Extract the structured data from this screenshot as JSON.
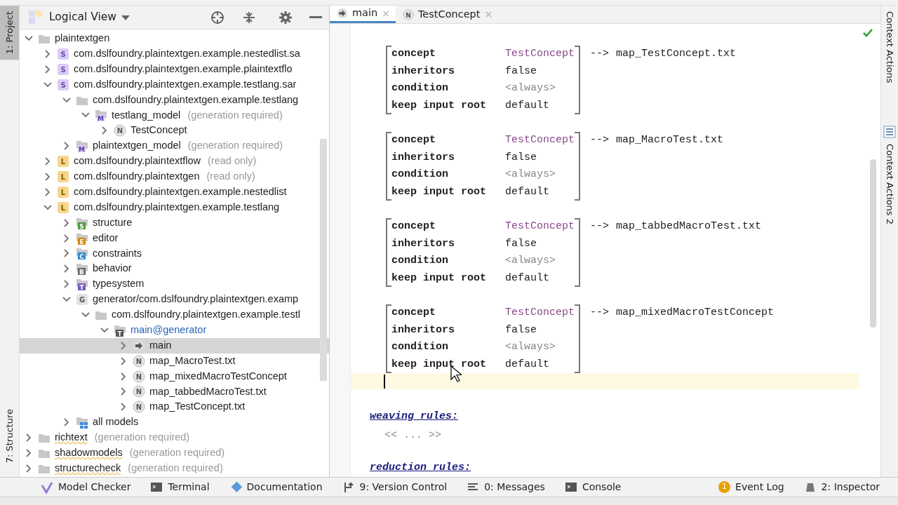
{
  "left_stripe": [
    {
      "label": "1: Project",
      "selected": true
    },
    {
      "label": "7: Structure",
      "selected": false
    }
  ],
  "project_panel": {
    "view": "Logical View",
    "tree": [
      {
        "label": "plaintextgen",
        "kind": "folder",
        "expanded": true,
        "children": [
          {
            "label": "com.dslfoundry.plaintextgen.example.nestedlist.sa",
            "kind": "solution",
            "badge": "S",
            "expanded": false
          },
          {
            "label": "com.dslfoundry.plaintextgen.example.plaintextflo",
            "kind": "solution",
            "badge": "S",
            "expanded": false
          },
          {
            "label": "com.dslfoundry.plaintextgen.example.testlang.sar",
            "kind": "solution",
            "badge": "S",
            "expanded": true,
            "children": [
              {
                "label": "com.dslfoundry.plaintextgen.example.testlang",
                "kind": "folder",
                "expanded": true,
                "children": [
                  {
                    "label": "testlang_model",
                    "note": "(generation required)",
                    "kind": "model",
                    "badge": "M",
                    "expanded": true,
                    "children": [
                      {
                        "label": "TestConcept",
                        "kind": "node",
                        "badge": "N",
                        "expanded": false
                      }
                    ]
                  }
                ]
              },
              {
                "label": "plaintextgen_model",
                "note": "(generation required)",
                "kind": "model",
                "badge": "M",
                "expanded": false
              }
            ]
          },
          {
            "label": "com.dslfoundry.plaintextflow",
            "note": "(read only)",
            "kind": "language",
            "badge": "L",
            "expanded": false
          },
          {
            "label": "com.dslfoundry.plaintextgen",
            "note": "(read only)",
            "kind": "language",
            "badge": "L",
            "expanded": false
          },
          {
            "label": "com.dslfoundry.plaintextgen.example.nestedlist",
            "kind": "language",
            "badge": "L",
            "expanded": false
          },
          {
            "label": "com.dslfoundry.plaintextgen.example.testlang",
            "kind": "language",
            "badge": "L",
            "expanded": true,
            "children": [
              {
                "label": "structure",
                "kind": "aspect",
                "badge": "S",
                "color": "#4a9a3a",
                "expanded": false
              },
              {
                "label": "editor",
                "kind": "aspect",
                "badge": "E",
                "color": "#d08a10",
                "expanded": false
              },
              {
                "label": "constraints",
                "kind": "aspect",
                "badge": "C",
                "color": "#2a8ad0",
                "expanded": false
              },
              {
                "label": "behavior",
                "kind": "aspect",
                "badge": "B",
                "color": "#6a6a6a",
                "expanded": false
              },
              {
                "label": "typesystem",
                "kind": "aspect",
                "badge": "T",
                "color": "#7a5ac0",
                "expanded": false
              },
              {
                "label": "generator/com.dslfoundry.plaintextgen.examp",
                "kind": "generator",
                "badge": "G",
                "expanded": true,
                "children": [
                  {
                    "label": "com.dslfoundry.plaintextgen.example.testl",
                    "kind": "folder",
                    "expanded": true,
                    "children": [
                      {
                        "label": "main@generator",
                        "kind": "aspect",
                        "badge": "T",
                        "color": "#555555",
                        "link": true,
                        "expanded": true,
                        "children": [
                          {
                            "label": "main",
                            "kind": "mapping",
                            "expanded": false,
                            "selected": true
                          },
                          {
                            "label": "map_MacroTest.txt",
                            "kind": "node",
                            "badge": "N",
                            "expanded": false
                          },
                          {
                            "label": "map_mixedMacroTestConcept",
                            "kind": "node",
                            "badge": "N",
                            "expanded": false
                          },
                          {
                            "label": "map_tabbedMacroTest.txt",
                            "kind": "node",
                            "badge": "N",
                            "expanded": false
                          },
                          {
                            "label": "map_TestConcept.txt",
                            "kind": "node",
                            "badge": "N",
                            "expanded": false
                          }
                        ]
                      }
                    ]
                  }
                ]
              },
              {
                "label": "all models",
                "kind": "models",
                "expanded": false
              }
            ]
          }
        ]
      },
      {
        "label": "richtext",
        "note": "(generation required)",
        "kind": "folder",
        "misspelled": true,
        "expanded": false
      },
      {
        "label": "shadowmodels",
        "note": "(generation required)",
        "kind": "folder",
        "misspelled": true,
        "expanded": false
      },
      {
        "label": "structurecheck",
        "note": "(generation required)",
        "kind": "folder",
        "misspelled": true,
        "expanded": false
      }
    ]
  },
  "editor_tabs": [
    {
      "label": "main",
      "kind": "mapping",
      "close": "×",
      "selected": true
    },
    {
      "label": "TestConcept",
      "kind": "node",
      "badge": "N",
      "close": "×",
      "selected": false
    }
  ],
  "editor": {
    "rules": [
      {
        "fields": [
          {
            "label": "concept",
            "value": "TestConcept",
            "kind": "ref"
          },
          {
            "label": "inheritors",
            "value": "false",
            "kind": "plain"
          },
          {
            "label": "condition",
            "value": "<always>",
            "kind": "default"
          },
          {
            "label": "keep input root",
            "value": "default",
            "kind": "plain"
          }
        ],
        "arrow": "-->",
        "target": "map_TestConcept.txt"
      },
      {
        "fields": [
          {
            "label": "concept",
            "value": "TestConcept",
            "kind": "ref"
          },
          {
            "label": "inheritors",
            "value": "false",
            "kind": "plain"
          },
          {
            "label": "condition",
            "value": "<always>",
            "kind": "default"
          },
          {
            "label": "keep input root",
            "value": "default",
            "kind": "plain"
          }
        ],
        "arrow": "-->",
        "target": "map_MacroTest.txt"
      },
      {
        "fields": [
          {
            "label": "concept",
            "value": "TestConcept",
            "kind": "ref"
          },
          {
            "label": "inheritors",
            "value": "false",
            "kind": "plain"
          },
          {
            "label": "condition",
            "value": "<always>",
            "kind": "default"
          },
          {
            "label": "keep input root",
            "value": "default",
            "kind": "plain"
          }
        ],
        "arrow": "-->",
        "target": "map_tabbedMacroTest.txt"
      },
      {
        "fields": [
          {
            "label": "concept",
            "value": "TestConcept",
            "kind": "ref"
          },
          {
            "label": "inheritors",
            "value": "false",
            "kind": "plain"
          },
          {
            "label": "condition",
            "value": "<always>",
            "kind": "default"
          },
          {
            "label": "keep input root",
            "value": "default",
            "kind": "plain"
          }
        ],
        "arrow": "-->",
        "target": "map_mixedMacroTestConcept"
      }
    ],
    "sections": [
      {
        "title": "weaving rules:",
        "placeholder": "<< ... >>"
      },
      {
        "title": "reduction rules:"
      }
    ]
  },
  "right_stripe": [
    {
      "label": "Context Actions"
    },
    {
      "label": "Context Actions 2"
    }
  ],
  "bottom_bar": {
    "left": [
      {
        "label": "Model Checker",
        "kind": "check"
      },
      {
        "label": "Terminal",
        "kind": "terminal"
      },
      {
        "label": "Documentation",
        "kind": "doc"
      },
      {
        "label": "9: Version Control",
        "kind": "vcs"
      },
      {
        "label": "0: Messages",
        "kind": "messages"
      },
      {
        "label": "Console",
        "kind": "terminal"
      }
    ],
    "right": [
      {
        "label": "Event Log",
        "count": "1"
      },
      {
        "label": "2: Inspector",
        "kind": "inspector"
      }
    ]
  }
}
